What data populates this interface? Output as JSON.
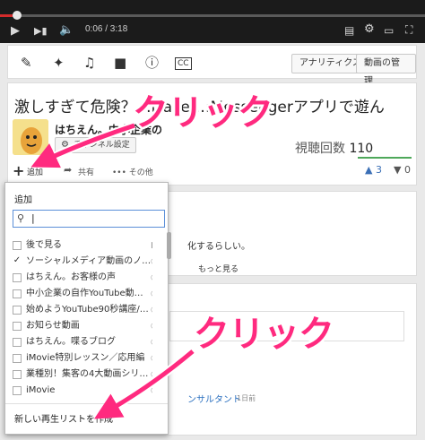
{
  "player": {
    "time": "0:06 / 3:18",
    "progress": 0.03
  },
  "toolbar": {
    "analytics_label": "アナリティクス",
    "manage_label": "動画の管理"
  },
  "video": {
    "title": "激しすぎて危険？…ıFace…:Messengerアプリで遊ん",
    "channel_name": "はちえん。中小企業の",
    "channel_button": "チャンネル設定",
    "views_label": "視聴回数",
    "views_count": "110",
    "add_label": "追加",
    "share_label": "共有",
    "more_label": "••• その他",
    "likes": "3",
    "dislikes": "0"
  },
  "description": {
    "text": "化するらしい。",
    "more": "もっと見る"
  },
  "comments": {
    "consultant": "ンサルタント",
    "ago": "1日前"
  },
  "playlist_popup": {
    "title": "追加",
    "search_value": "",
    "items": [
      {
        "label": "後で見る",
        "checked": false,
        "icon": "lock-icon"
      },
      {
        "label": "ソーシャルメディア動画のノウハ…",
        "checked": true,
        "icon": "globe-icon"
      },
      {
        "label": "はちえん。お客様の声",
        "checked": false,
        "icon": "globe-icon"
      },
      {
        "label": "中小企業の自作YouTube動画…",
        "checked": false,
        "icon": "globe-icon"
      },
      {
        "label": "始めようYouTube90秒講座/ビ…",
        "checked": false,
        "icon": "globe-icon"
      },
      {
        "label": "お知らせ動画",
        "checked": false,
        "icon": "globe-icon"
      },
      {
        "label": "はちえん。喋るブログ",
        "checked": false,
        "icon": "globe-icon"
      },
      {
        "label": "iMovie特別レッスン／応用編",
        "checked": false,
        "icon": "globe-icon"
      },
      {
        "label": "業種別！集客の4大動画シリーズ",
        "checked": false,
        "icon": "globe-icon"
      },
      {
        "label": "iMovie",
        "checked": false,
        "icon": "globe-icon"
      }
    ],
    "new_list_label": "新しい再生リストを作成"
  },
  "annotations": {
    "click_1": "クリック",
    "click_2": "クリック",
    "color": "#ff2a7f"
  }
}
